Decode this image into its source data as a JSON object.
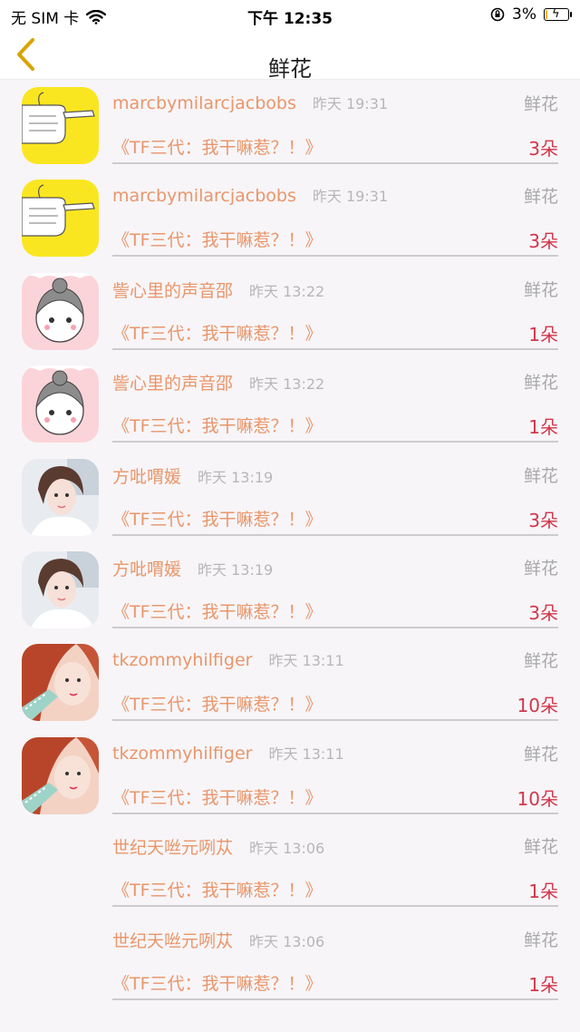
{
  "status_bar": {
    "carrier": "无 SIM 卡",
    "time": "下午 12:35",
    "battery": "3%",
    "battery_level": 0.03
  },
  "nav": {
    "title": "鲜花"
  },
  "rows": [
    {
      "user": "marcbymilarcjacbobs",
      "time": "昨天 19:31",
      "kind": "鲜花",
      "book": "《TF三代：我干嘛惹？！》",
      "count": "3朵",
      "avatar": "thumb-gun-yellow"
    },
    {
      "user": "marcbymilarcjacbobs",
      "time": "昨天 19:31",
      "kind": "鲜花",
      "book": "《TF三代：我干嘛惹？！》",
      "count": "3朵",
      "avatar": "thumb-gun-yellow"
    },
    {
      "user": "訾心里的声音邵",
      "time": "昨天 13:22",
      "kind": "鲜花",
      "book": "《TF三代：我干嘛惹？！》",
      "count": "1朵",
      "avatar": "cartoon-girl-pink"
    },
    {
      "user": "訾心里的声音邵",
      "time": "昨天 13:22",
      "kind": "鲜花",
      "book": "《TF三代：我干嘛惹？！》",
      "count": "1朵",
      "avatar": "cartoon-girl-pink"
    },
    {
      "user": "方吡喟媛",
      "time": "昨天 13:19",
      "kind": "鲜花",
      "book": "《TF三代：我干嘛惹？！》",
      "count": "3朵",
      "avatar": "photo-girl-white"
    },
    {
      "user": "方吡喟媛",
      "time": "昨天 13:19",
      "kind": "鲜花",
      "book": "《TF三代：我干嘛惹？！》",
      "count": "3朵",
      "avatar": "photo-girl-white"
    },
    {
      "user": "tkzommyhilfiger",
      "time": "昨天 13:11",
      "kind": "鲜花",
      "book": "《TF三代：我干嘛惹？！》",
      "count": "10朵",
      "avatar": "photo-girl-red"
    },
    {
      "user": "tkzommyhilfiger",
      "time": "昨天 13:11",
      "kind": "鲜花",
      "book": "《TF三代：我干嘛惹？！》",
      "count": "10朵",
      "avatar": "photo-girl-red"
    },
    {
      "user": "世纪天咝元咧苁",
      "time": "昨天 13:06",
      "kind": "鲜花",
      "book": "《TF三代：我干嘛惹？！》",
      "count": "1朵",
      "avatar": ""
    },
    {
      "user": "世纪天咝元咧苁",
      "time": "昨天 13:06",
      "kind": "鲜花",
      "book": "《TF三代：我干嘛惹？！》",
      "count": "1朵",
      "avatar": ""
    }
  ],
  "colors": {
    "username": "#e9966a",
    "count": "#d2364a",
    "muted": "#a9a9a9",
    "back_arrow": "#d9a400"
  }
}
